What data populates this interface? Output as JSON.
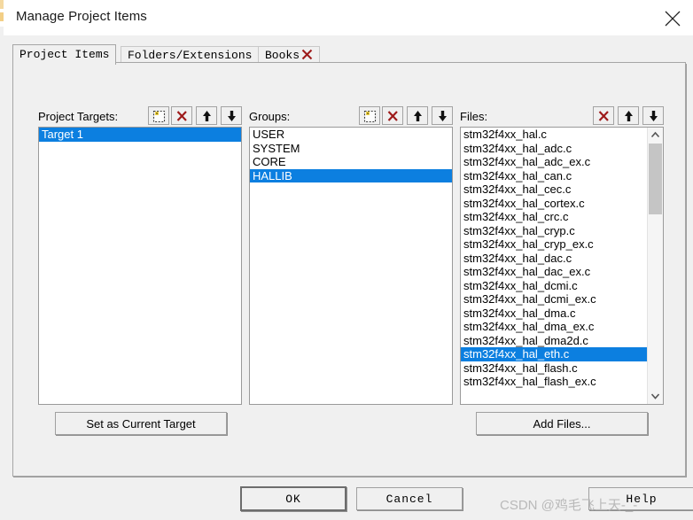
{
  "window": {
    "title": "Manage Project Items",
    "close_icon": "close-icon"
  },
  "tabs": [
    {
      "label": "Project Items",
      "active": true,
      "closable": false
    },
    {
      "label": "Folders/Extensions",
      "active": false,
      "closable": false
    },
    {
      "label": "Books",
      "active": false,
      "closable": true
    }
  ],
  "project_targets": {
    "label": "Project Targets:",
    "toolbar": [
      {
        "name": "new-item-icon",
        "title": "New (Insert)"
      },
      {
        "name": "delete-icon",
        "title": "Remove Item"
      },
      {
        "name": "arrow-up-icon",
        "title": "Move Up"
      },
      {
        "name": "arrow-down-icon",
        "title": "Move Down"
      }
    ],
    "items": [
      {
        "label": "Target 1",
        "selected": true
      }
    ]
  },
  "groups": {
    "label": "Groups:",
    "toolbar": [
      {
        "name": "new-item-icon",
        "title": "New (Insert)"
      },
      {
        "name": "delete-icon",
        "title": "Remove Item"
      },
      {
        "name": "arrow-up-icon",
        "title": "Move Up"
      },
      {
        "name": "arrow-down-icon",
        "title": "Move Down"
      }
    ],
    "items": [
      {
        "label": "USER",
        "selected": false
      },
      {
        "label": "SYSTEM",
        "selected": false
      },
      {
        "label": "CORE",
        "selected": false
      },
      {
        "label": "HALLIB",
        "selected": true
      }
    ]
  },
  "files": {
    "label": "Files:",
    "toolbar": [
      {
        "name": "delete-icon",
        "title": "Remove Item"
      },
      {
        "name": "arrow-up-icon",
        "title": "Move Up"
      },
      {
        "name": "arrow-down-icon",
        "title": "Move Down"
      }
    ],
    "items": [
      {
        "label": "stm32f4xx_hal.c",
        "selected": false
      },
      {
        "label": "stm32f4xx_hal_adc.c",
        "selected": false
      },
      {
        "label": "stm32f4xx_hal_adc_ex.c",
        "selected": false
      },
      {
        "label": "stm32f4xx_hal_can.c",
        "selected": false
      },
      {
        "label": "stm32f4xx_hal_cec.c",
        "selected": false
      },
      {
        "label": "stm32f4xx_hal_cortex.c",
        "selected": false
      },
      {
        "label": "stm32f4xx_hal_crc.c",
        "selected": false
      },
      {
        "label": "stm32f4xx_hal_cryp.c",
        "selected": false
      },
      {
        "label": "stm32f4xx_hal_cryp_ex.c",
        "selected": false
      },
      {
        "label": "stm32f4xx_hal_dac.c",
        "selected": false
      },
      {
        "label": "stm32f4xx_hal_dac_ex.c",
        "selected": false
      },
      {
        "label": "stm32f4xx_hal_dcmi.c",
        "selected": false
      },
      {
        "label": "stm32f4xx_hal_dcmi_ex.c",
        "selected": false
      },
      {
        "label": "stm32f4xx_hal_dma.c",
        "selected": false
      },
      {
        "label": "stm32f4xx_hal_dma_ex.c",
        "selected": false
      },
      {
        "label": "stm32f4xx_hal_dma2d.c",
        "selected": false
      },
      {
        "label": "stm32f4xx_hal_eth.c",
        "selected": true
      },
      {
        "label": "stm32f4xx_hal_flash.c",
        "selected": false
      },
      {
        "label": "stm32f4xx_hal_flash_ex.c",
        "selected": false
      }
    ],
    "scrollbar": {
      "up_icon": "chevron-up-icon",
      "down_icon": "chevron-down-icon",
      "thumb_top_pct": 4,
      "thumb_height_pct": 26
    }
  },
  "buttons": {
    "set_current_target": "Set as Current Target",
    "add_files": "Add Files...",
    "ok": "OK",
    "cancel": "Cancel",
    "help": "Help"
  },
  "watermark": {
    "text": "CSDN @鸡毛飞上天-_-"
  },
  "colors": {
    "selection_blue": "#0c7fe0",
    "dialog_gray": "#f0f0f0",
    "delete_red": "#9e1b1b",
    "border_gray": "#a0a0a0"
  }
}
